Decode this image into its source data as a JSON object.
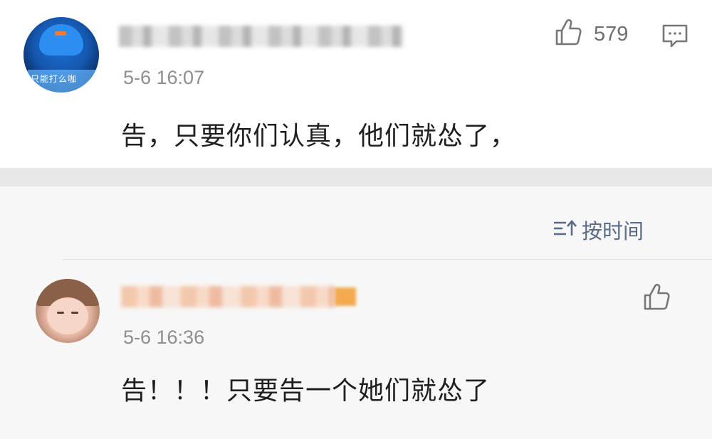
{
  "comments": [
    {
      "avatar_text": "只能打么咖",
      "timestamp": "5-6 16:07",
      "text": "告，只要你们认真，他们就怂了，",
      "like_count": "579"
    },
    {
      "timestamp": "5-6 16:36",
      "text": "告！！！只要告一个她们就怂了"
    }
  ],
  "sort": {
    "label": "按时间"
  },
  "icons": {
    "like": "thumbs-up-icon",
    "comment": "comment-bubble-icon",
    "sort": "sort-icon"
  },
  "colors": {
    "page_background": "#f7f7f7",
    "card_background": "#ffffff",
    "sort_accent": "#5c6b86",
    "timestamp_gray": "#8e8e8e"
  }
}
